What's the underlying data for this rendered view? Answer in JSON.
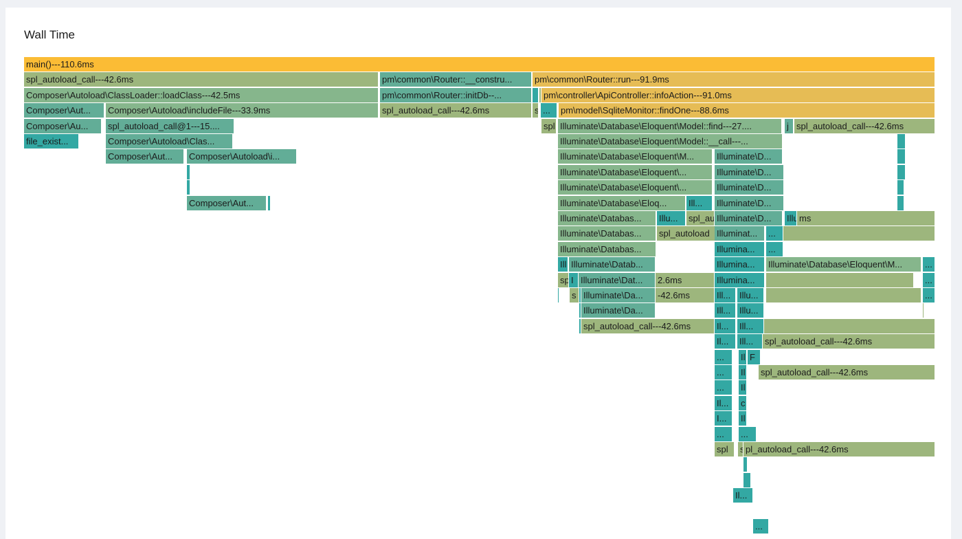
{
  "title": "Wall Time",
  "colors": {
    "gold": "#fbbc35",
    "amber": "#e6bc55",
    "olive": "#9db67d",
    "sage": "#86b68c",
    "green": "#62ad97",
    "teal": "#33a8a3",
    "tealDark": "#2ba09c"
  },
  "rows": [
    [
      [
        "main()---110.6ms",
        "gold"
      ]
    ],
    [
      [
        "spl_autoload_call---42.6ms",
        "olive"
      ],
      [
        "pm\\common\\Router::__constru...",
        "green"
      ],
      [
        "pm\\common\\Router::run---91.9ms",
        "amber"
      ]
    ],
    [
      [
        "Composer\\Autoload\\ClassLoader::loadClass---42.5ms",
        "sage"
      ],
      [
        "pm\\common\\Router::initDb--...",
        "green"
      ],
      [
        "",
        "teal"
      ],
      [
        "",
        "olive"
      ],
      [
        "pm\\controller\\ApiController::infoAction---91.0ms",
        "amber"
      ]
    ],
    [
      [
        "Composer\\Aut...",
        "green"
      ],
      [
        "Composer\\Autoload\\includeFile---33.9ms",
        "sage"
      ],
      [
        "spl_autoload_call---42.6ms",
        "olive"
      ],
      [
        "s",
        "olive"
      ],
      [
        "...",
        "teal"
      ],
      [
        "",
        "olive"
      ],
      [
        "pm\\model\\SqliteMonitor::findOne---88.6ms",
        "amber"
      ]
    ],
    [
      [
        "Composer\\Au...",
        "green"
      ],
      [
        "spl_autoload_call@1---15....",
        "green"
      ],
      [
        "spl",
        "olive"
      ],
      [
        "Illuminate\\Database\\Eloquent\\Model::find---27....",
        "sage"
      ],
      [
        "",
        "teal"
      ],
      [
        "j",
        "green"
      ],
      [
        "spl_autoload_call---42.6ms",
        "olive"
      ]
    ],
    [
      [
        "file_exist...",
        "teal"
      ],
      [
        "Composer\\Autoload\\Clas...",
        "green"
      ],
      [
        "Illuminate\\Database\\Eloquent\\Model::__call---...",
        "sage"
      ],
      [
        "",
        "teal"
      ],
      [
        "",
        "teal"
      ]
    ],
    [
      [
        "Composer\\Aut...",
        "green"
      ],
      [
        "Composer\\Autoload\\i...",
        "green"
      ],
      [
        "Illuminate\\Database\\Eloquent\\M...",
        "sage"
      ],
      [
        "Illuminate\\D...",
        "green"
      ],
      [
        "",
        "teal"
      ]
    ],
    [
      [
        "",
        "teal"
      ],
      [
        "Illuminate\\Database\\Eloquent\\...",
        "sage"
      ],
      [
        "Illuminate\\D...",
        "green"
      ],
      [
        "",
        "teal"
      ]
    ],
    [
      [
        "",
        "teal"
      ],
      [
        "Illuminate\\Database\\Eloquent\\...",
        "sage"
      ],
      [
        "Illuminate\\D...",
        "green"
      ],
      [
        "",
        "teal"
      ]
    ],
    [
      [
        "Composer\\Aut...",
        "green"
      ],
      [
        "",
        "teal"
      ],
      [
        "Illuminate\\Database\\Eloq...",
        "sage"
      ],
      [
        "Ill...",
        "teal"
      ],
      [
        "Illuminate\\D...",
        "green"
      ],
      [
        "",
        "teal"
      ]
    ],
    [
      [
        "Illuminate\\Databas...",
        "sage"
      ],
      [
        "Illu...",
        "teal"
      ],
      [
        "spl_au",
        "olive"
      ],
      [
        "Illuminate\\D...",
        "green"
      ],
      [
        "Illu",
        "teal"
      ],
      [
        "ms",
        "olive"
      ]
    ],
    [
      [
        "Illuminate\\Databas...",
        "sage"
      ],
      [
        "spl_autoload",
        "olive"
      ],
      [
        "Illuminat...",
        "green"
      ],
      [
        "...",
        "teal"
      ],
      [
        "",
        "olive"
      ]
    ],
    [
      [
        "Illuminate\\Databas...",
        "sage"
      ],
      [
        "Illumina...",
        "teal"
      ],
      [
        "...",
        "teal"
      ]
    ],
    [
      [
        "Ill",
        "teal"
      ],
      [
        "Illuminate\\Datab...",
        "green"
      ],
      [
        "Illumina...",
        "teal"
      ],
      [
        "Illuminate\\Database\\Eloquent\\M...",
        "sage"
      ],
      [
        "...",
        "teal"
      ]
    ],
    [
      [
        "sp",
        "olive"
      ],
      [
        "I",
        "teal"
      ],
      [
        "Illuminate\\Dat...",
        "green"
      ],
      [
        "2.6ms",
        "olive"
      ],
      [
        "Illumina...",
        "teal"
      ],
      [
        "",
        "olive"
      ],
      [
        "...",
        "teal"
      ]
    ],
    [
      [
        "",
        "teal"
      ],
      [
        "s",
        "olive"
      ],
      [
        "",
        "teal"
      ],
      [
        "Illuminate\\Da...",
        "green"
      ],
      [
        "-42.6ms",
        "olive"
      ],
      [
        "Ill...",
        "teal"
      ],
      [
        "Illu...",
        "teal"
      ],
      [
        "",
        "olive"
      ],
      [
        "...",
        "teal"
      ]
    ],
    [
      [
        "",
        "teal"
      ],
      [
        "Illuminate\\Da...",
        "green"
      ],
      [
        "Ill...",
        "teal"
      ],
      [
        "Illu...",
        "teal"
      ],
      [
        "",
        "olive"
      ]
    ],
    [
      [
        "",
        "teal"
      ],
      [
        "spl_autoload_call---42.6ms",
        "olive"
      ],
      [
        "Il...",
        "teal"
      ],
      [
        "Ill...",
        "teal"
      ],
      [
        "",
        "olive"
      ]
    ],
    [
      [
        "Il...",
        "teal"
      ],
      [
        "Ill...",
        "teal"
      ],
      [
        "spl_autoload_call---42.6ms",
        "olive"
      ]
    ],
    [
      [
        "...",
        "teal"
      ],
      [
        "Il",
        "teal"
      ],
      [
        "F",
        "teal"
      ]
    ],
    [
      [
        "...",
        "teal"
      ],
      [
        "Il",
        "teal"
      ],
      [
        "spl_autoload_call---42.6ms",
        "olive"
      ]
    ],
    [
      [
        "...",
        "teal"
      ],
      [
        "Il",
        "teal"
      ]
    ],
    [
      [
        "Il...",
        "teal"
      ],
      [
        "c",
        "teal"
      ]
    ],
    [
      [
        "I...",
        "teal"
      ],
      [
        "Il",
        "teal"
      ]
    ],
    [
      [
        "...",
        "teal"
      ],
      [
        "...",
        "teal"
      ]
    ],
    [
      [
        "spl",
        "olive"
      ],
      [
        "s",
        "olive"
      ],
      [
        "pl_autoload_call---42.6ms",
        "olive"
      ]
    ],
    [
      [
        "",
        "teal"
      ]
    ],
    [
      [
        "",
        "teal"
      ]
    ],
    [
      [
        "Il...",
        "teal"
      ]
    ],
    [],
    [
      [
        "...",
        "teal"
      ]
    ]
  ]
}
